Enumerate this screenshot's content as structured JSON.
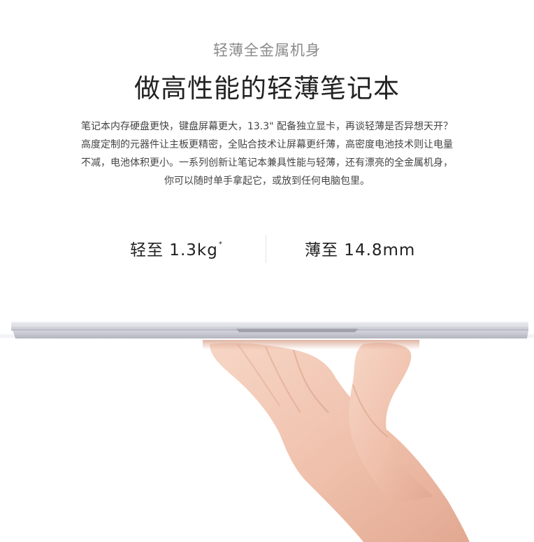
{
  "header": {
    "subtitle": "轻薄全金属机身",
    "title": "做高性能的轻薄笔记本"
  },
  "description": {
    "lines": [
      "笔记本内存硬盘更快，键盘屏幕更大，13.3\" 配备独立显卡，再谈轻薄是否异想天开？",
      "高度定制的元器件让主板更精密，全贴合技术让屏幕更纤薄，高密度电池技术则让电量",
      "不减，电池体积更小。一系列创新让笔记本兼具性能与轻薄，还有漂亮的全金属机身，",
      "你可以随时单手拿起它，或放到任何电脑包里。"
    ]
  },
  "specs": {
    "weight_label": "轻至 1.3kg",
    "weight_mark": "*",
    "thin_label": "薄至 14.8mm"
  },
  "colors": {
    "laptop_body": "#dcdde3",
    "laptop_edge": "#b9bbc4",
    "skin": "#f3c9b6"
  },
  "image": {
    "subject": "laptop-held-on-one-hand"
  }
}
